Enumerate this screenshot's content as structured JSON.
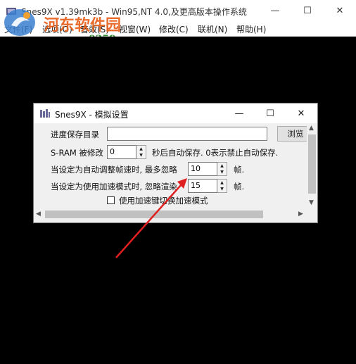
{
  "window": {
    "title": "Snes9X v1.39mk3b - Win95,NT 4.0,及更高版本操作系统",
    "minimize": "—",
    "maximize": "☐",
    "close": "✕"
  },
  "menubar": {
    "items": [
      "文件(F)",
      "选项(O)",
      "音效(S)",
      "视窗(W)",
      "修改(C)",
      "联机(N)",
      "帮助(H)"
    ]
  },
  "watermark": {
    "text": "河东软件园",
    "url": "www.pc0359.cn"
  },
  "dialog": {
    "title": "Snes9X - 模拟设置",
    "minimize": "—",
    "maximize": "☐",
    "close": "✕",
    "save_dir_label": "进度保存目录",
    "save_dir_value": "",
    "browse_label": "浏览",
    "sram_label": "S-RAM 被修改",
    "sram_value": "0",
    "sram_suffix": "秒后自动保存. 0表示禁止自动保存.",
    "auto_skip_label": "当设定为自动调整帧速时, 最多忽略",
    "auto_skip_value": "10",
    "auto_skip_suffix": "帧.",
    "turbo_skip_label": "当设定为使用加速模式时, 忽略渲染",
    "turbo_skip_value": "15",
    "turbo_skip_suffix": "帧.",
    "turbo_toggle_label": "使用加速键切换加速模式",
    "turbo_toggle_checked": false
  },
  "colors": {
    "annotation_arrow": "#e02020",
    "watermark_orange": "#e8601c",
    "watermark_green": "#2f8f2f"
  }
}
